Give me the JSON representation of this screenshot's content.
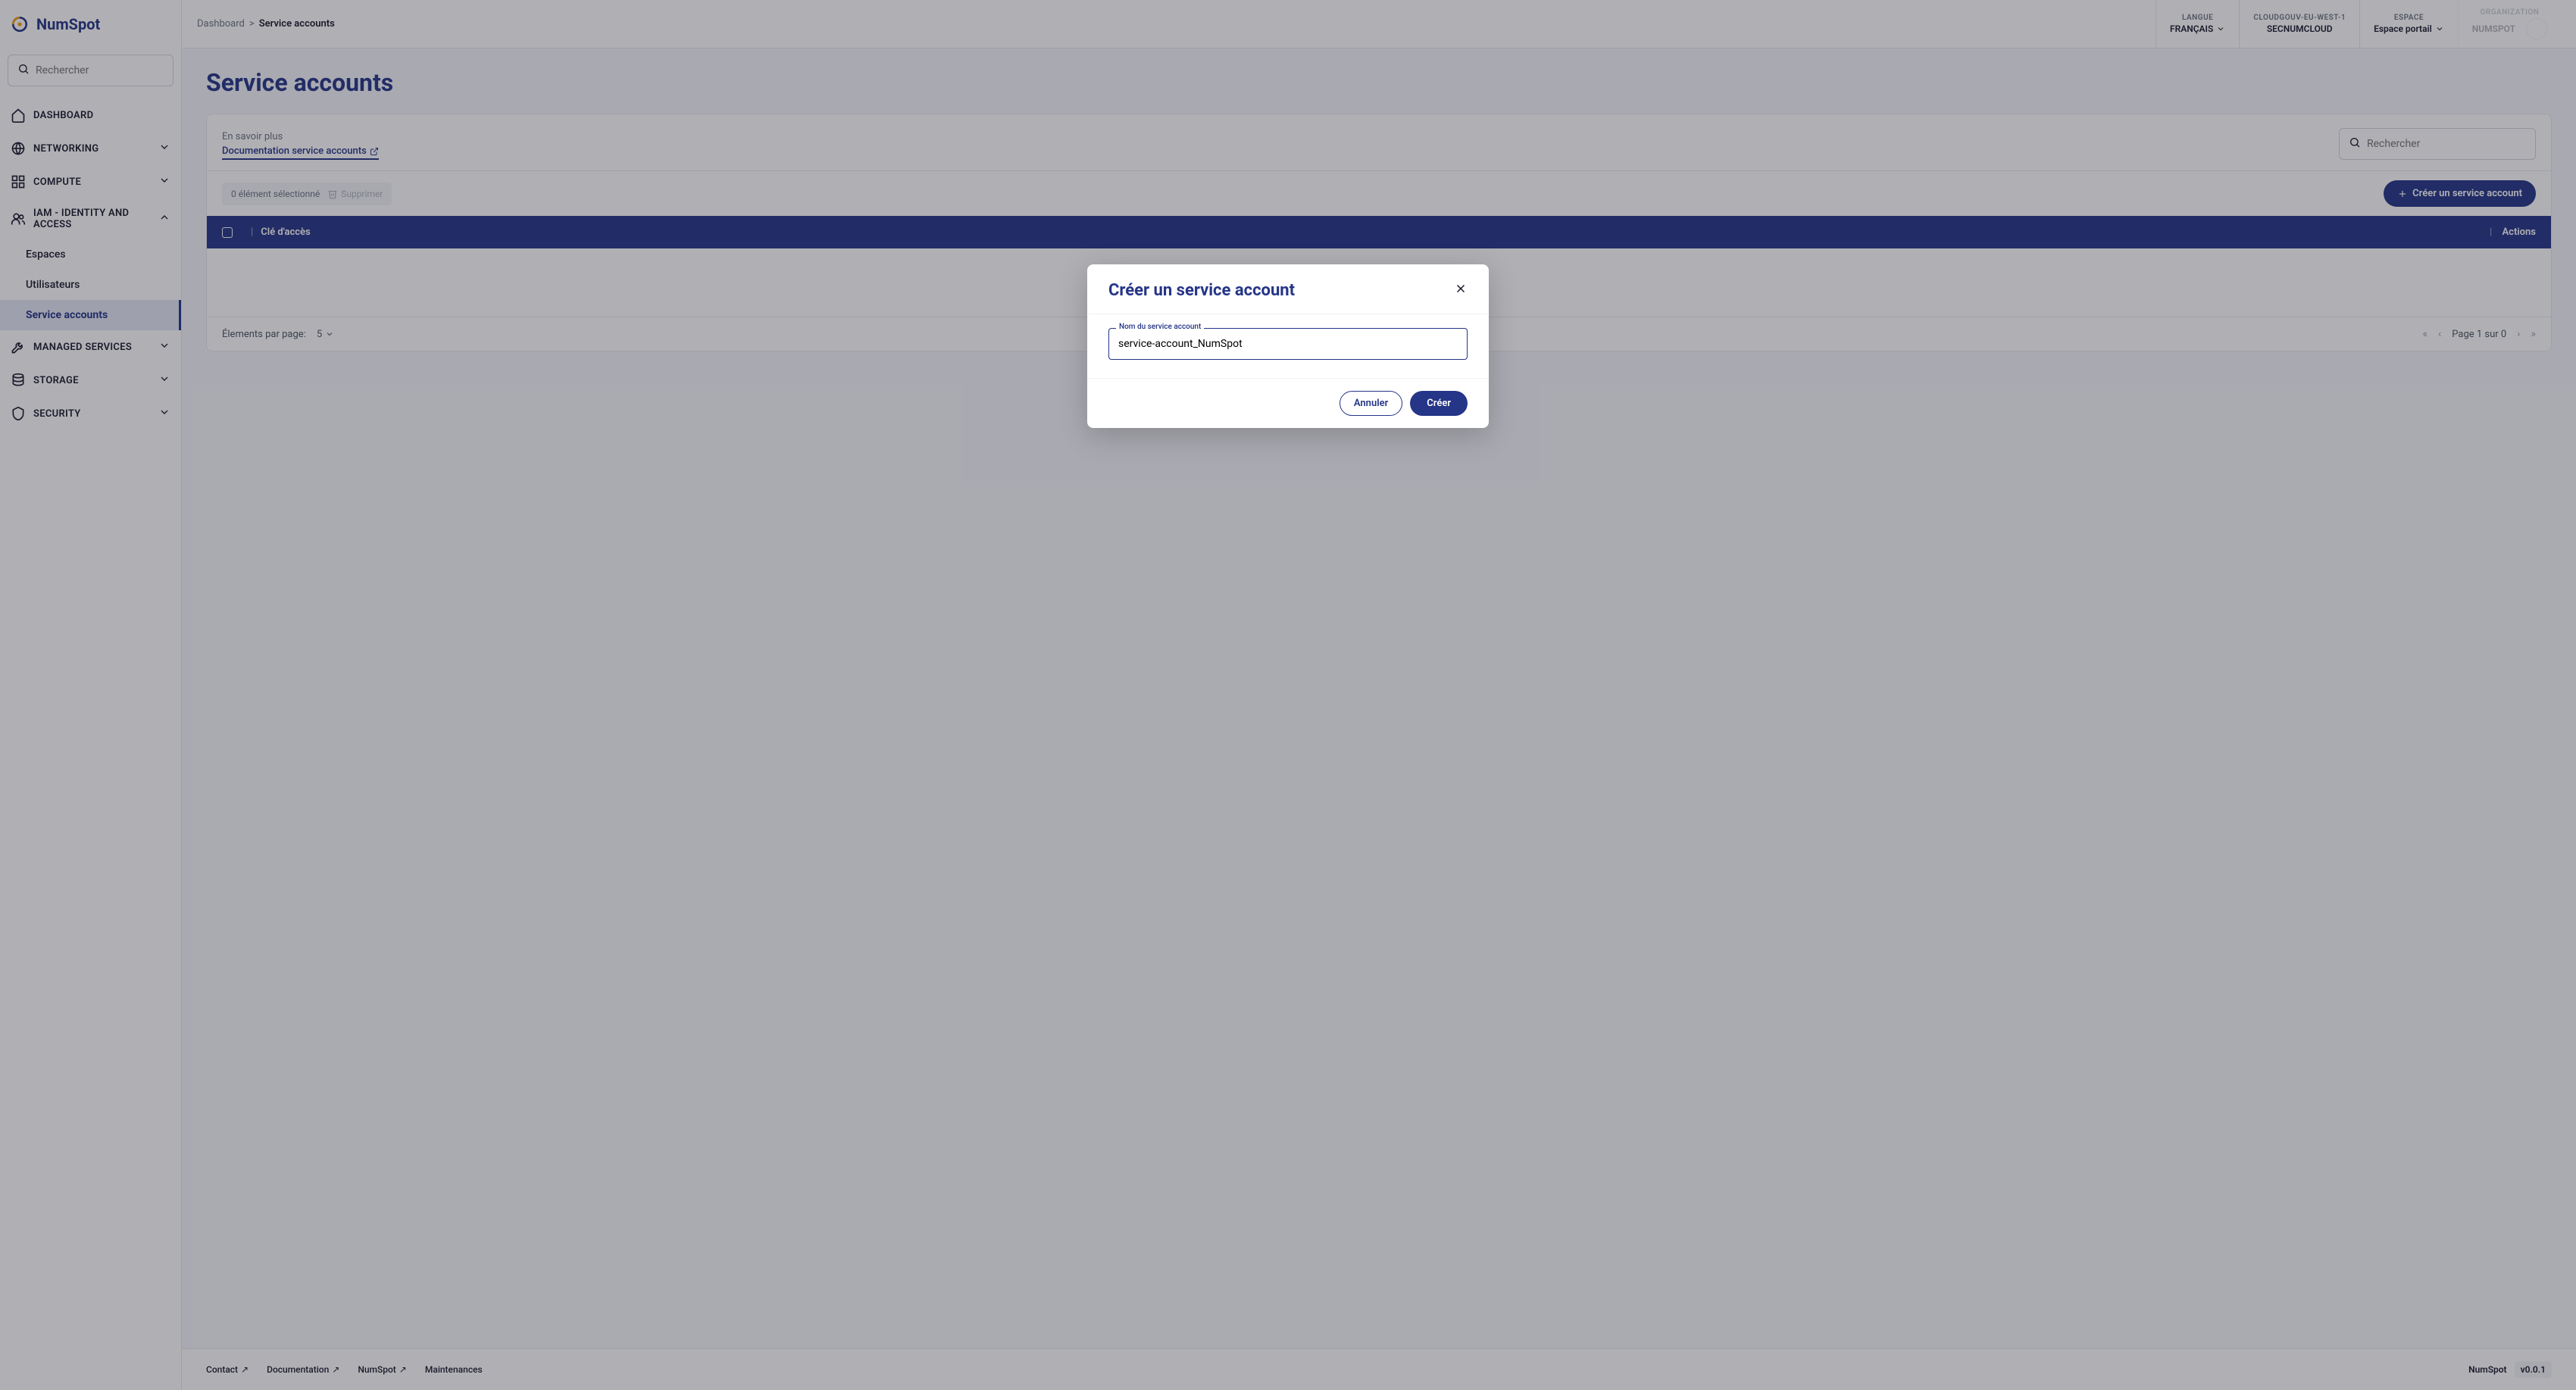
{
  "brand": "NumSpot",
  "sidebar": {
    "search_placeholder": "Rechercher",
    "items": [
      {
        "label": "DASHBOARD"
      },
      {
        "label": "NETWORKING"
      },
      {
        "label": "COMPUTE"
      },
      {
        "label": "IAM - IDENTITY AND ACCESS"
      },
      {
        "label": "MANAGED SERVICES"
      },
      {
        "label": "STORAGE"
      },
      {
        "label": "SECURITY"
      }
    ],
    "iam_children": [
      {
        "label": "Espaces"
      },
      {
        "label": "Utilisateurs"
      },
      {
        "label": "Service accounts"
      }
    ]
  },
  "breadcrumb": {
    "root": "Dashboard",
    "sep": ">",
    "current": "Service accounts"
  },
  "topbar": {
    "langue_label": "LANGUE",
    "langue_value": "FRANÇAIS",
    "region_label": "CLOUDGOUV-EU-WEST-1",
    "region_value": "SECNUMCLOUD",
    "espace_label": "ESPACE",
    "espace_value": "Espace portail",
    "org_label": "ORGANIZATION",
    "org_value": "NUMSPOT"
  },
  "page": {
    "title": "Service accounts",
    "learn_more": "En savoir plus",
    "doc_link": "Documentation service accounts",
    "search_placeholder": "Rechercher",
    "selected_count": "0 élément sélectionné",
    "delete_label": "Supprimer",
    "create_button": "Créer un service account",
    "col_key": "Clé d'accès",
    "col_actions": "Actions",
    "per_page_label": "Élements par page:",
    "per_page_value": "5",
    "page_info": "Page 1 sur 0"
  },
  "modal": {
    "title": "Créer un service account",
    "field_label": "Nom du service account",
    "field_value": "service-account_NumSpot",
    "cancel": "Annuler",
    "create": "Créer"
  },
  "footer": {
    "links": [
      {
        "label": "Contact"
      },
      {
        "label": "Documentation"
      },
      {
        "label": "NumSpot"
      },
      {
        "label": "Maintenances"
      }
    ],
    "brand": "NumSpot",
    "version": "v0.0.1"
  }
}
